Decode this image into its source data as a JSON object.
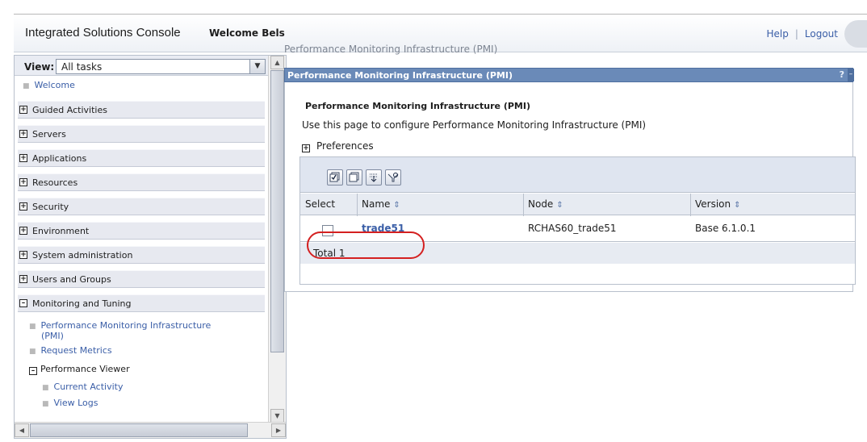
{
  "header": {
    "title": "Integrated Solutions Console",
    "welcome": "Welcome Bels",
    "help": "Help",
    "separator": "|",
    "logout": "Logout"
  },
  "nav": {
    "view_label": "View:",
    "view_value": "All tasks",
    "welcome": "Welcome",
    "categories": [
      {
        "label": "Guided Activities",
        "expanded": false
      },
      {
        "label": "Servers",
        "expanded": false
      },
      {
        "label": "Applications",
        "expanded": false
      },
      {
        "label": "Resources",
        "expanded": false
      },
      {
        "label": "Security",
        "expanded": false
      },
      {
        "label": "Environment",
        "expanded": false
      },
      {
        "label": "System administration",
        "expanded": false
      },
      {
        "label": "Users and Groups",
        "expanded": false
      },
      {
        "label": "Monitoring and Tuning",
        "expanded": true
      }
    ],
    "monitoring_items": {
      "pmi_line1": "Performance Monitoring Infrastructure",
      "pmi_line2": "(PMI)",
      "request_metrics": "Request Metrics",
      "performance_viewer": "Performance Viewer",
      "current_activity": "Current Activity",
      "view_logs": "View Logs"
    }
  },
  "content": {
    "breadcrumb": "Performance Monitoring Infrastructure (PMI)",
    "portlet_title": "Performance Monitoring Infrastructure (PMI)",
    "portlet_help": "?",
    "portlet_min": "–",
    "heading": "Performance Monitoring Infrastructure (PMI)",
    "description": "Use this page to configure Performance Monitoring Infrastructure (PMI)",
    "preferences": "Preferences",
    "table": {
      "columns": [
        "Select",
        "Name",
        "Node",
        "Version"
      ],
      "rows": [
        {
          "selected": false,
          "name": "trade51",
          "node": "RCHAS60_trade51",
          "version": "Base 6.1.0.1"
        }
      ],
      "total": "Total 1"
    }
  },
  "colors": {
    "portlet_bar": "#6a8ab8",
    "link": "#3a5ea7",
    "highlight": "#d42020"
  }
}
